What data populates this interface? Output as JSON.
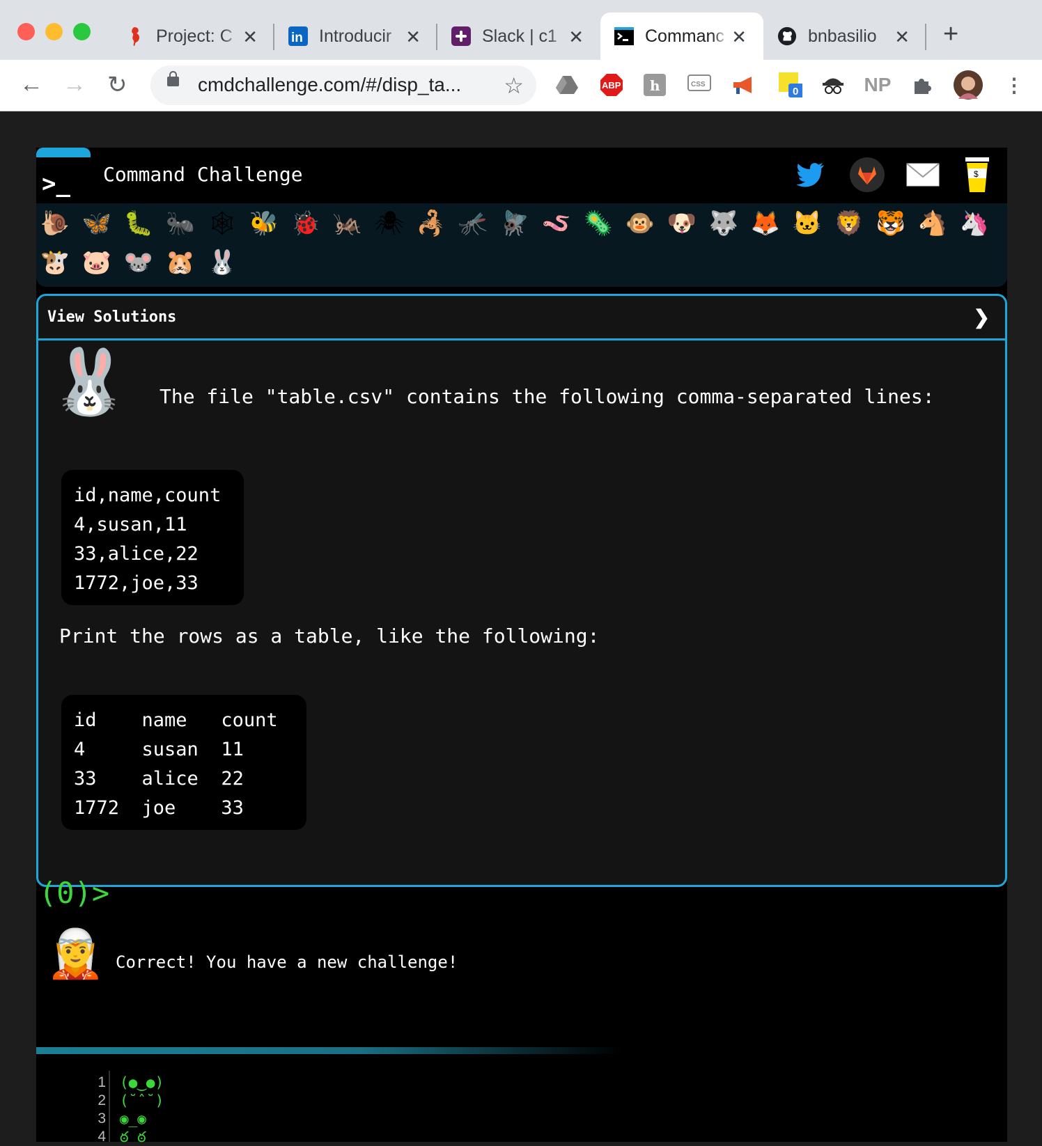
{
  "browser": {
    "tabs": [
      {
        "title": "Project: C",
        "icon": "seahorse-icon"
      },
      {
        "title": "Introducir",
        "icon": "linkedin-icon"
      },
      {
        "title": "Slack | c1",
        "icon": "slack-icon"
      },
      {
        "title": "Commanc",
        "icon": "terminal-icon"
      },
      {
        "title": "bnbasilio",
        "icon": "github-icon"
      }
    ],
    "url": "cmdchallenge.com/#/disp_ta...",
    "extensions": [
      "google-drive-icon",
      "adblock-plus-icon",
      "hypothesis-icon",
      "css-viewer-icon",
      "megaphone-icon",
      "sticky-note-icon",
      "spy-icon",
      "np-icon",
      "puzzle-icon",
      "profile-avatar"
    ],
    "ext_labels": {
      "abp": "ABP",
      "np": "NP",
      "badge": "0"
    }
  },
  "header": {
    "logo": ">_",
    "title": "Command Challenge"
  },
  "levels": [
    "🐌",
    "🦋",
    "🐛",
    "🐜",
    "🕸",
    "🐝",
    "🐞",
    "🦗",
    "🕷",
    "🦂",
    "🦟",
    "🪰",
    "🪱",
    "🦠",
    "🐵",
    "🐶",
    "🐺",
    "🦊",
    "🐱",
    "🦁",
    "🐯",
    "🐴",
    "🦄",
    "🐮",
    "🐷",
    "🐭",
    "🐹",
    "🐰"
  ],
  "panel": {
    "heading": "View Solutions",
    "chevron": "❯",
    "challenge_icon": "🐰",
    "intro": "The file \"table.csv\" contains the following comma-separated lines:",
    "csv_lines": [
      "id,name,count",
      "4,susan,11",
      "33,alice,22",
      "1772,joe,33"
    ],
    "instruction": "Print the rows as a table, like the following:",
    "table_lines": [
      "id    name   count",
      "4     susan  11",
      "33    alice  22",
      "1772  joe    33"
    ]
  },
  "prompt": "(0)>",
  "feedback": {
    "icon": "🧝",
    "text": "Correct! You have a new challenge!"
  },
  "output": {
    "line_numbers": [
      "1",
      "2",
      "3",
      "4"
    ],
    "lines": [
      "(●‿●)",
      "(˘ˆ˘)",
      "◉_◉",
      "ఠ ఠ"
    ]
  },
  "colors": {
    "accent": "#1ea5d9",
    "prompt_green": "#3bd83b",
    "page_bg": "#000000"
  }
}
